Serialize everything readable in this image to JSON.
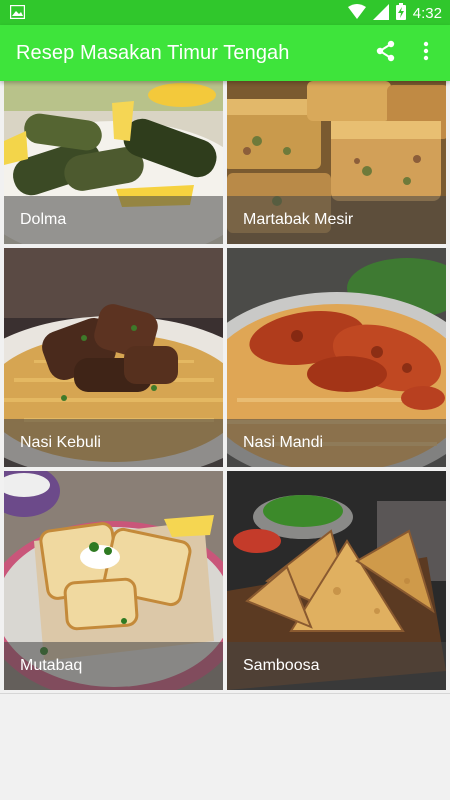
{
  "status_bar": {
    "time": "4:32",
    "icons": [
      "image-notification-icon",
      "wifi-icon",
      "signal-icon",
      "battery-charging-icon"
    ]
  },
  "app_bar": {
    "title": "Resep Masakan Timur Tengah",
    "actions": [
      "share-icon",
      "more-vert-icon"
    ]
  },
  "colors": {
    "status_bar": "#30c72c",
    "app_bar": "#3ee43b",
    "caption_overlay": "rgba(70,70,70,0.55)",
    "background": "#f1f1f1"
  },
  "recipes": [
    {
      "title": "Dolma"
    },
    {
      "title": "Martabak Mesir"
    },
    {
      "title": "Nasi Kebuli"
    },
    {
      "title": "Nasi Mandi"
    },
    {
      "title": "Mutabaq"
    },
    {
      "title": "Samboosa"
    }
  ]
}
